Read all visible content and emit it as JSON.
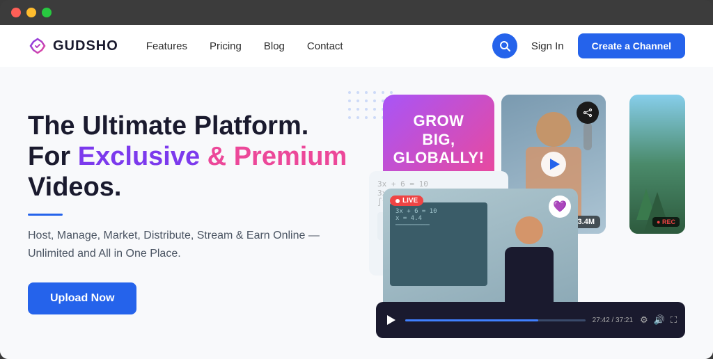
{
  "browser": {
    "traffic_lights": [
      "red",
      "yellow",
      "green"
    ]
  },
  "navbar": {
    "logo_text": "GUDSHO",
    "nav_links": [
      {
        "label": "Features",
        "id": "features"
      },
      {
        "label": "Pricing",
        "id": "pricing"
      },
      {
        "label": "Blog",
        "id": "blog"
      },
      {
        "label": "Contact",
        "id": "contact"
      }
    ],
    "sign_in_label": "Sign In",
    "create_channel_label": "Create a Channel",
    "search_icon": "🔍"
  },
  "hero": {
    "title_line1": "The Ultimate Platform.",
    "title_line2_prefix": "For ",
    "title_exclusive": "Exclusive",
    "title_ampersand": " & ",
    "title_premium": "Premium",
    "title_line3": "Videos.",
    "subtitle": "Host, Manage, Market, Distribute, Stream & Earn Online — Unlimited and All in One Place.",
    "upload_btn_label": "Upload Now"
  },
  "video_cards": {
    "grow_big": "GROW\nBIG,\nGLOBALLY!",
    "views_badge": "● 3.4M",
    "live_badge": "● LIVE",
    "rec_badge": "● REC",
    "player_time": "27:42 / 37:21"
  },
  "colors": {
    "primary_blue": "#2563eb",
    "purple": "#7c3aed",
    "pink": "#ec4899",
    "red": "#ef4444"
  }
}
